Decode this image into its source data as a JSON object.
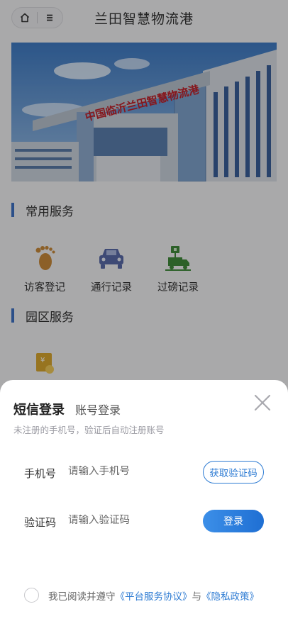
{
  "header": {
    "title": "兰田智慧物流港",
    "capsule": {
      "home_icon": "home-icon",
      "menu_icon": "menu-icon"
    }
  },
  "banner": {
    "sign_text": "中国临沂兰田智慧物流港",
    "sky_color": "#4f86c8"
  },
  "sections": {
    "common": {
      "title": "常用服务",
      "items": [
        {
          "label": "访客登记",
          "icon": "footprint-icon"
        },
        {
          "label": "通行记录",
          "icon": "car-icon"
        },
        {
          "label": "过磅记录",
          "icon": "weighbridge-truck-icon"
        }
      ]
    },
    "park": {
      "title": "园区服务",
      "items": [
        {
          "label": "",
          "icon": "coin-document-icon"
        }
      ]
    }
  },
  "login": {
    "tab_active": "短信登录",
    "tab_other": "账号登录",
    "hint": "未注册的手机号，验证后自动注册账号",
    "phone": {
      "label": "手机号",
      "placeholder": "请输入手机号",
      "value": ""
    },
    "code": {
      "label": "验证码",
      "placeholder": "请输入验证码",
      "value": ""
    },
    "get_code_button": "获取验证码",
    "login_button": "登录",
    "agreement": {
      "prefix": "我已阅读并遵守",
      "link1": "《平台服务协议》",
      "middle": "与",
      "link2": "《隐私政策》",
      "checked": false
    }
  },
  "colors": {
    "accent": "#2d7bd3",
    "section_bar": "#3e72c4"
  }
}
